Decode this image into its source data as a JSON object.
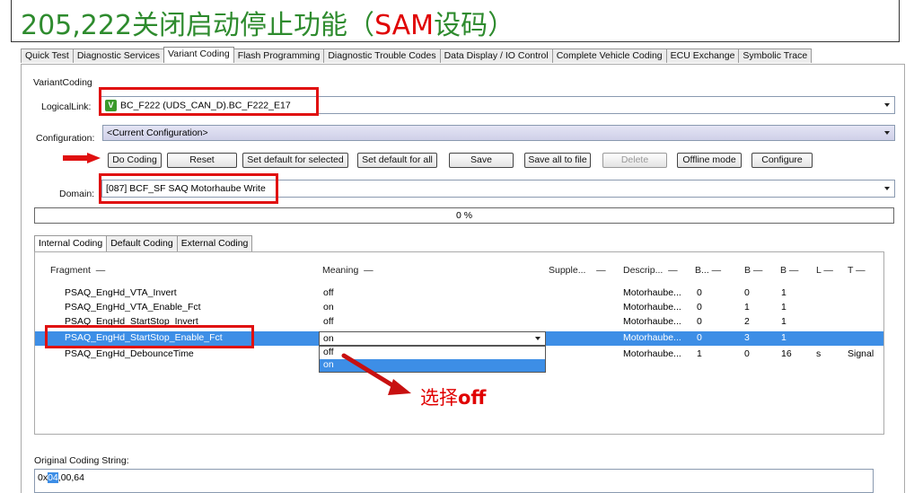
{
  "banner": {
    "prefix": "205,222关闭启动停止功能（",
    "code": "SAM",
    "suffix": "设码）"
  },
  "tabs": [
    "Quick Test",
    "Diagnostic Services",
    "Variant Coding",
    "Flash Programming",
    "Diagnostic Trouble Codes",
    "Data Display / IO Control",
    "Complete Vehicle Coding",
    "ECU Exchange",
    "Symbolic Trace"
  ],
  "active_tab": "Variant Coding",
  "section_title": "VariantCoding",
  "logical_link": {
    "label": "LogicalLink:",
    "badge": "V",
    "value": "BC_F222 (UDS_CAN_D).BC_F222_E17"
  },
  "configuration": {
    "label": "Configuration:",
    "value": "<Current Configuration>"
  },
  "buttons": {
    "do_coding": "Do Coding",
    "reset": "Reset",
    "set_default_selected": "Set default for selected",
    "set_default_all": "Set default for all",
    "save": "Save",
    "save_all": "Save all to file",
    "delete": "Delete",
    "offline": "Offline mode",
    "configure": "Configure"
  },
  "domain": {
    "label": "Domain:",
    "value": "[087] BCF_SF SAQ Motorhaube Write"
  },
  "progress": {
    "text": "0 %",
    "value": 0
  },
  "subtabs": [
    "Internal Coding",
    "Default Coding",
    "External Coding"
  ],
  "columns": {
    "fragment": "Fragment",
    "meaning": "Meaning",
    "supple": "Supple...",
    "descrip": "Descrip...",
    "b1": "B...",
    "b2": "B",
    "b3": "B",
    "l": "L",
    "t": "T"
  },
  "rows": [
    {
      "fragment": "PSAQ_EngHd_VTA_Invert",
      "meaning": "off",
      "descrip": "Motorhaube...",
      "b1": "0",
      "b2": "0",
      "b3": "1",
      "l": "",
      "t": ""
    },
    {
      "fragment": "PSAQ_EngHd_VTA_Enable_Fct",
      "meaning": "on",
      "descrip": "Motorhaube...",
      "b1": "0",
      "b2": "1",
      "b3": "1",
      "l": "",
      "t": ""
    },
    {
      "fragment": "PSAQ_EngHd_StartStop_Invert",
      "meaning": "off",
      "descrip": "Motorhaube...",
      "b1": "0",
      "b2": "2",
      "b3": "1",
      "l": "",
      "t": ""
    },
    {
      "fragment": "PSAQ_EngHd_StartStop_Enable_Fct",
      "meaning": "on",
      "descrip": "Motorhaube...",
      "b1": "0",
      "b2": "3",
      "b3": "1",
      "l": "",
      "t": ""
    },
    {
      "fragment": "PSAQ_EngHd_DebounceTime",
      "meaning": "off",
      "descrip": "Motorhaube...",
      "b1": "1",
      "b2": "0",
      "b3": "16",
      "l": "s",
      "t": "Signal"
    }
  ],
  "dropdown": {
    "value": "on",
    "options": [
      "off",
      "on"
    ],
    "highlighted": "on"
  },
  "annotation": {
    "prefix": "选择",
    "word": "off"
  },
  "original_coding": {
    "label": "Original Coding String:",
    "prefix": "0x",
    "highlight": "04",
    "rest": ",00,64"
  },
  "colors": {
    "green": "#2e8b2e",
    "red": "#e00000",
    "selection": "#3d8ee6"
  }
}
